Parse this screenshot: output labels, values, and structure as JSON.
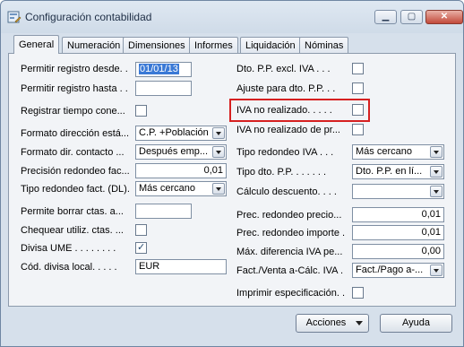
{
  "window": {
    "title": "Configuración contabilidad",
    "controls": {
      "minimize": "▁",
      "maximize": "▢",
      "close": "✕"
    }
  },
  "tabs": [
    "General",
    "Numeración",
    "Dimensiones",
    "Informes",
    "Liquidación",
    "Nóminas"
  ],
  "left": {
    "permitir_desde": {
      "label": "Permitir registro desde. .",
      "value": "01/01/13"
    },
    "permitir_hasta": {
      "label": "Permitir registro hasta . .",
      "value": ""
    },
    "registrar_tiempo": {
      "label": "Registrar tiempo cone...",
      "checked": false
    },
    "formato_direccion": {
      "label": "Formato dirección está...",
      "value": "C.P. +Población"
    },
    "formato_contacto": {
      "label": "Formato dir. contacto ...",
      "value": "Después emp..."
    },
    "precision_redondeo": {
      "label": "Precisión redondeo fac...",
      "value": "0,01"
    },
    "tipo_redondeo_fact": {
      "label": "Tipo redondeo fact. (DL).",
      "value": "Más cercano"
    },
    "permite_borrar": {
      "label": "Permite borrar ctas. a...",
      "value": ""
    },
    "chequear_utiliz": {
      "label": "Chequear utiliz. ctas. ...",
      "checked": false
    },
    "divisa_ume": {
      "label": "Divisa UME . . . . . . . .",
      "checked": true
    },
    "cod_divisa": {
      "label": "Cód. divisa local. . . . .",
      "value": "EUR"
    }
  },
  "right": {
    "dto_pp_excl": {
      "label": "Dto. P.P. excl. IVA . . .",
      "checked": false
    },
    "ajuste_dto": {
      "label": "Ajuste para dto. P.P. . .",
      "checked": false
    },
    "iva_no_realizado": {
      "label": "IVA no realizado. . . . .",
      "checked": false
    },
    "iva_no_realizado_pr": {
      "label": "IVA no realizado de pr...",
      "checked": false
    },
    "tipo_redondeo_iva": {
      "label": "Tipo redondeo IVA . . .",
      "value": "Más cercano"
    },
    "tipo_dto_pp": {
      "label": "Tipo dto. P.P. . . . . . .",
      "value": "Dto. P.P. en lí..."
    },
    "calculo_descuento": {
      "label": "Cálculo descuento. . . .",
      "value": ""
    },
    "prec_redondeo_precio": {
      "label": "Prec. redondeo precio...",
      "value": "0,01"
    },
    "prec_redondeo_importe": {
      "label": "Prec. redondeo importe .",
      "value": "0,01"
    },
    "max_diferencia_iva": {
      "label": "Máx. diferencia IVA pe...",
      "value": "0,00"
    },
    "fact_venta": {
      "label": "Fact./Venta a-Cálc. IVA .",
      "value": "Fact./Pago a-..."
    },
    "imprimir_especificacion": {
      "label": "Imprimir especificación. .",
      "checked": false
    }
  },
  "buttons": {
    "acciones": "Acciones",
    "ayuda": "Ayuda"
  },
  "icons": {
    "check": "✓"
  },
  "colors": {
    "highlight_border": "#d62020",
    "selection": "#3a79d6"
  }
}
